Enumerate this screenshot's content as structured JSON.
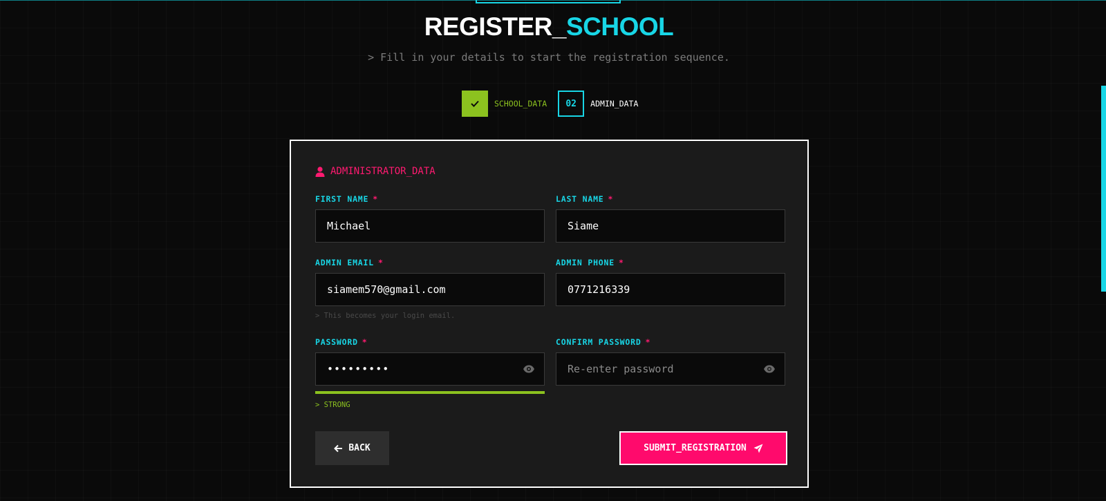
{
  "header": {
    "title_main": "REGISTER_",
    "title_accent": "SCHOOL",
    "subtitle": "> Fill in your details to start the registration sequence."
  },
  "stepper": {
    "steps": [
      {
        "badge": "",
        "label": "SCHOOL_DATA",
        "state": "done"
      },
      {
        "badge": "02",
        "label": "ADMIN_DATA",
        "state": "active"
      }
    ]
  },
  "form": {
    "section_title": "ADMINISTRATOR_DATA",
    "required_mark": "*",
    "first_name": {
      "label": "FIRST NAME",
      "value": "Michael"
    },
    "last_name": {
      "label": "LAST NAME",
      "value": "Siame"
    },
    "admin_email": {
      "label": "ADMIN EMAIL",
      "value": "siamem570@gmail.com",
      "hint": "> This becomes your login email."
    },
    "admin_phone": {
      "label": "ADMIN PHONE",
      "value": "0771216339"
    },
    "password": {
      "label": "PASSWORD",
      "value": "•••••••••",
      "strength": "> STRONG",
      "strength_level": 1.0
    },
    "confirm_password": {
      "label": "CONFIRM PASSWORD",
      "value": "",
      "placeholder": "Re-enter password"
    }
  },
  "actions": {
    "back_label": "BACK",
    "submit_label": "SUBMIT_REGISTRATION"
  },
  "colors": {
    "cyan": "#18d6e6",
    "pink": "#ff0a6c",
    "green": "#8cc21f",
    "card_bg": "#1b1b1b"
  },
  "icons": [
    "check-icon",
    "user-icon",
    "eye-icon",
    "arrow-left-icon",
    "send-icon"
  ]
}
